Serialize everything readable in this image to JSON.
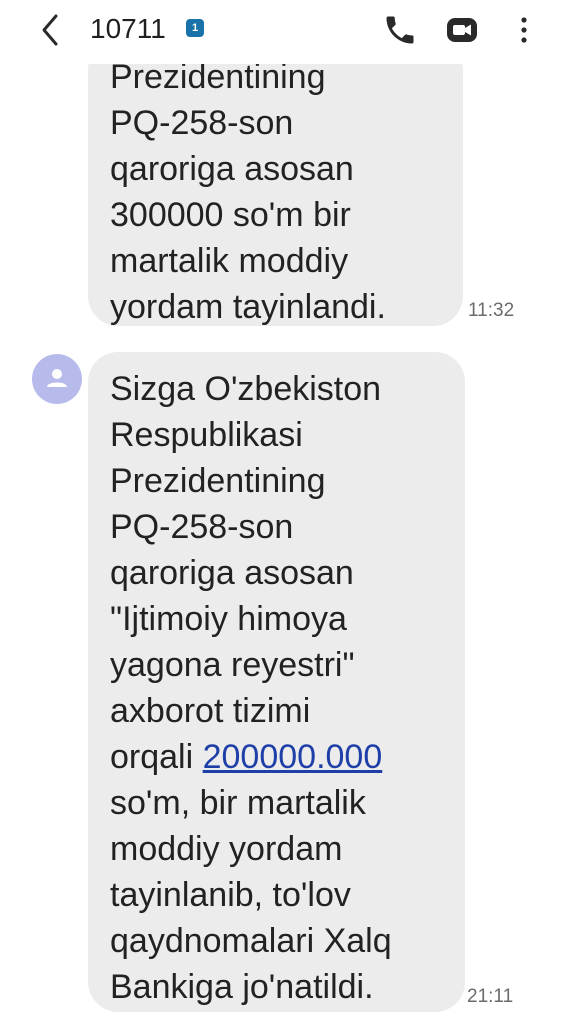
{
  "header": {
    "contact": "10711",
    "sim_badge": "1"
  },
  "messages": [
    {
      "lines": [
        "Prezidentining",
        "PQ-258-son",
        "qaroriga asosan",
        "300000 so'm bir",
        "martalik moddiy",
        "yordam tayinlandi."
      ],
      "time": "11:32"
    },
    {
      "lines": [
        "Sizga O'zbekiston",
        "Respublikasi",
        "Prezidentining",
        "PQ-258-son",
        "qaroriga asosan",
        "\"Ijtimoiy himoya",
        "yagona reyestri\"",
        "axborot tizimi"
      ],
      "link_prefix": "orqali ",
      "link_text": "200000.000",
      "lines_after": [
        "so'm, bir martalik",
        "moddiy yordam",
        "tayinlanib, to'lov",
        "qaydnomalari Xalq",
        "Bankiga jo'natildi."
      ],
      "time": "21:11"
    }
  ],
  "icons": [
    "back-arrow-icon",
    "phone-icon",
    "video-call-icon",
    "more-vertical-icon",
    "person-icon"
  ]
}
